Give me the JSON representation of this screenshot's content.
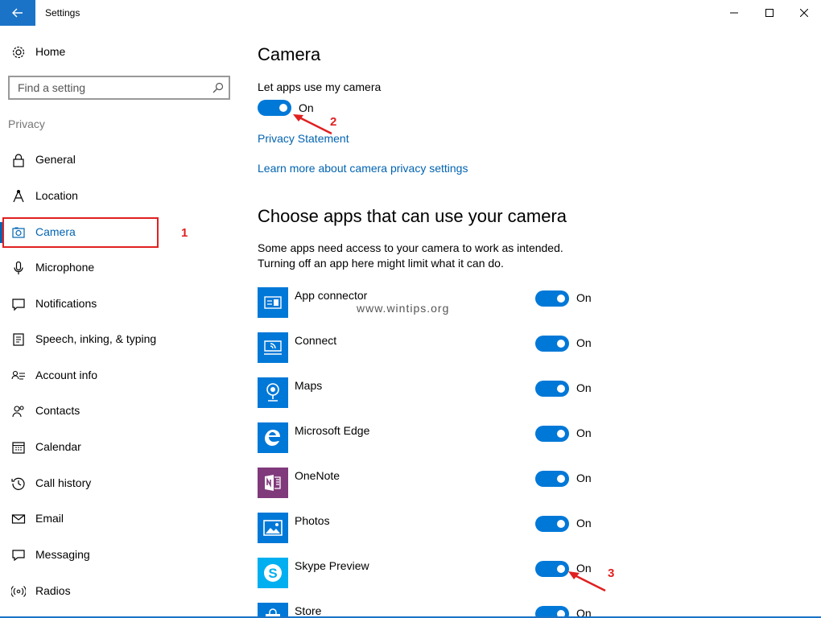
{
  "window": {
    "title": "Settings",
    "back_icon": "back-arrow-icon",
    "accent": "#0078d7"
  },
  "sidebar": {
    "home_label": "Home",
    "search_placeholder": "Find a setting",
    "section": "Privacy",
    "items": [
      {
        "label": "General",
        "icon": "lock-icon"
      },
      {
        "label": "Location",
        "icon": "location-icon"
      },
      {
        "label": "Camera",
        "icon": "camera-icon",
        "active": true
      },
      {
        "label": "Microphone",
        "icon": "microphone-icon"
      },
      {
        "label": "Notifications",
        "icon": "notifications-icon"
      },
      {
        "label": "Speech, inking, & typing",
        "icon": "speech-icon"
      },
      {
        "label": "Account info",
        "icon": "account-info-icon"
      },
      {
        "label": "Contacts",
        "icon": "contacts-icon"
      },
      {
        "label": "Calendar",
        "icon": "calendar-icon"
      },
      {
        "label": "Call history",
        "icon": "call-history-icon"
      },
      {
        "label": "Email",
        "icon": "email-icon"
      },
      {
        "label": "Messaging",
        "icon": "messaging-icon"
      },
      {
        "label": "Radios",
        "icon": "radios-icon"
      }
    ]
  },
  "main": {
    "title": "Camera",
    "toggle_label": "Let apps use my camera",
    "toggle_state": "On",
    "privacy_link": "Privacy Statement",
    "learn_more_link": "Learn more about camera privacy settings",
    "apps_heading": "Choose apps that can use your camera",
    "apps_desc_line1": "Some apps need access to your camera to work as intended.",
    "apps_desc_line2": "Turning off an app here might limit what it can do.",
    "apps": [
      {
        "name": "App connector",
        "state": "On",
        "icon": "app-connector-icon"
      },
      {
        "name": "Connect",
        "state": "On",
        "icon": "connect-icon"
      },
      {
        "name": "Maps",
        "state": "On",
        "icon": "maps-icon"
      },
      {
        "name": "Microsoft Edge",
        "state": "On",
        "icon": "edge-icon"
      },
      {
        "name": "OneNote",
        "state": "On",
        "icon": "onenote-icon"
      },
      {
        "name": "Photos",
        "state": "On",
        "icon": "photos-icon"
      },
      {
        "name": "Skype Preview",
        "state": "On",
        "icon": "skype-icon"
      },
      {
        "name": "Store",
        "state": "On",
        "icon": "store-icon"
      }
    ]
  },
  "annotations": {
    "step1": "1",
    "step2": "2",
    "step3": "3",
    "color": "#e02020"
  },
  "watermark": "www.wintips.org"
}
